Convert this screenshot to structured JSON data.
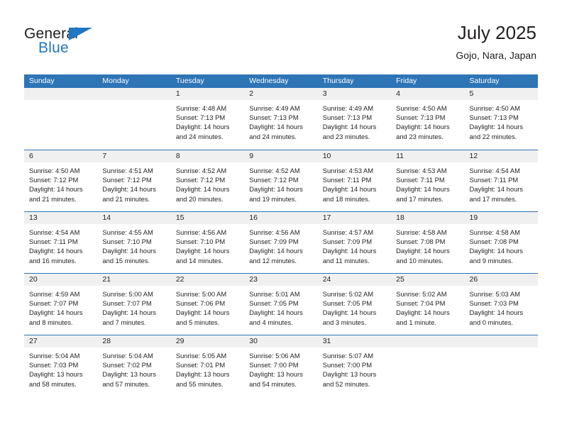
{
  "logo": {
    "top_word": "General",
    "bottom_word": "Blue",
    "flag_icon": "triangle-flag-icon"
  },
  "header": {
    "title": "July 2025",
    "location": "Gojo, Nara, Japan"
  },
  "colors": {
    "header_blue": "#2e75b6",
    "daynum_band": "#f0f0f0",
    "logo_blue": "#1f76c2",
    "text": "#231f20"
  },
  "calendar": {
    "weekday_headers": [
      "Sunday",
      "Monday",
      "Tuesday",
      "Wednesday",
      "Thursday",
      "Friday",
      "Saturday"
    ],
    "weeks": [
      [
        {
          "day": "",
          "lines": []
        },
        {
          "day": "",
          "lines": []
        },
        {
          "day": "1",
          "lines": [
            "Sunrise: 4:48 AM",
            "Sunset: 7:13 PM",
            "Daylight: 14 hours",
            "and 24 minutes."
          ]
        },
        {
          "day": "2",
          "lines": [
            "Sunrise: 4:49 AM",
            "Sunset: 7:13 PM",
            "Daylight: 14 hours",
            "and 24 minutes."
          ]
        },
        {
          "day": "3",
          "lines": [
            "Sunrise: 4:49 AM",
            "Sunset: 7:13 PM",
            "Daylight: 14 hours",
            "and 23 minutes."
          ]
        },
        {
          "day": "4",
          "lines": [
            "Sunrise: 4:50 AM",
            "Sunset: 7:13 PM",
            "Daylight: 14 hours",
            "and 23 minutes."
          ]
        },
        {
          "day": "5",
          "lines": [
            "Sunrise: 4:50 AM",
            "Sunset: 7:13 PM",
            "Daylight: 14 hours",
            "and 22 minutes."
          ]
        }
      ],
      [
        {
          "day": "6",
          "lines": [
            "Sunrise: 4:50 AM",
            "Sunset: 7:12 PM",
            "Daylight: 14 hours",
            "and 21 minutes."
          ]
        },
        {
          "day": "7",
          "lines": [
            "Sunrise: 4:51 AM",
            "Sunset: 7:12 PM",
            "Daylight: 14 hours",
            "and 21 minutes."
          ]
        },
        {
          "day": "8",
          "lines": [
            "Sunrise: 4:52 AM",
            "Sunset: 7:12 PM",
            "Daylight: 14 hours",
            "and 20 minutes."
          ]
        },
        {
          "day": "9",
          "lines": [
            "Sunrise: 4:52 AM",
            "Sunset: 7:12 PM",
            "Daylight: 14 hours",
            "and 19 minutes."
          ]
        },
        {
          "day": "10",
          "lines": [
            "Sunrise: 4:53 AM",
            "Sunset: 7:11 PM",
            "Daylight: 14 hours",
            "and 18 minutes."
          ]
        },
        {
          "day": "11",
          "lines": [
            "Sunrise: 4:53 AM",
            "Sunset: 7:11 PM",
            "Daylight: 14 hours",
            "and 17 minutes."
          ]
        },
        {
          "day": "12",
          "lines": [
            "Sunrise: 4:54 AM",
            "Sunset: 7:11 PM",
            "Daylight: 14 hours",
            "and 17 minutes."
          ]
        }
      ],
      [
        {
          "day": "13",
          "lines": [
            "Sunrise: 4:54 AM",
            "Sunset: 7:11 PM",
            "Daylight: 14 hours",
            "and 16 minutes."
          ]
        },
        {
          "day": "14",
          "lines": [
            "Sunrise: 4:55 AM",
            "Sunset: 7:10 PM",
            "Daylight: 14 hours",
            "and 15 minutes."
          ]
        },
        {
          "day": "15",
          "lines": [
            "Sunrise: 4:56 AM",
            "Sunset: 7:10 PM",
            "Daylight: 14 hours",
            "and 14 minutes."
          ]
        },
        {
          "day": "16",
          "lines": [
            "Sunrise: 4:56 AM",
            "Sunset: 7:09 PM",
            "Daylight: 14 hours",
            "and 12 minutes."
          ]
        },
        {
          "day": "17",
          "lines": [
            "Sunrise: 4:57 AM",
            "Sunset: 7:09 PM",
            "Daylight: 14 hours",
            "and 11 minutes."
          ]
        },
        {
          "day": "18",
          "lines": [
            "Sunrise: 4:58 AM",
            "Sunset: 7:08 PM",
            "Daylight: 14 hours",
            "and 10 minutes."
          ]
        },
        {
          "day": "19",
          "lines": [
            "Sunrise: 4:58 AM",
            "Sunset: 7:08 PM",
            "Daylight: 14 hours",
            "and 9 minutes."
          ]
        }
      ],
      [
        {
          "day": "20",
          "lines": [
            "Sunrise: 4:59 AM",
            "Sunset: 7:07 PM",
            "Daylight: 14 hours",
            "and 8 minutes."
          ]
        },
        {
          "day": "21",
          "lines": [
            "Sunrise: 5:00 AM",
            "Sunset: 7:07 PM",
            "Daylight: 14 hours",
            "and 7 minutes."
          ]
        },
        {
          "day": "22",
          "lines": [
            "Sunrise: 5:00 AM",
            "Sunset: 7:06 PM",
            "Daylight: 14 hours",
            "and 5 minutes."
          ]
        },
        {
          "day": "23",
          "lines": [
            "Sunrise: 5:01 AM",
            "Sunset: 7:05 PM",
            "Daylight: 14 hours",
            "and 4 minutes."
          ]
        },
        {
          "day": "24",
          "lines": [
            "Sunrise: 5:02 AM",
            "Sunset: 7:05 PM",
            "Daylight: 14 hours",
            "and 3 minutes."
          ]
        },
        {
          "day": "25",
          "lines": [
            "Sunrise: 5:02 AM",
            "Sunset: 7:04 PM",
            "Daylight: 14 hours",
            "and 1 minute."
          ]
        },
        {
          "day": "26",
          "lines": [
            "Sunrise: 5:03 AM",
            "Sunset: 7:03 PM",
            "Daylight: 14 hours",
            "and 0 minutes."
          ]
        }
      ],
      [
        {
          "day": "27",
          "lines": [
            "Sunrise: 5:04 AM",
            "Sunset: 7:03 PM",
            "Daylight: 13 hours",
            "and 58 minutes."
          ]
        },
        {
          "day": "28",
          "lines": [
            "Sunrise: 5:04 AM",
            "Sunset: 7:02 PM",
            "Daylight: 13 hours",
            "and 57 minutes."
          ]
        },
        {
          "day": "29",
          "lines": [
            "Sunrise: 5:05 AM",
            "Sunset: 7:01 PM",
            "Daylight: 13 hours",
            "and 55 minutes."
          ]
        },
        {
          "day": "30",
          "lines": [
            "Sunrise: 5:06 AM",
            "Sunset: 7:00 PM",
            "Daylight: 13 hours",
            "and 54 minutes."
          ]
        },
        {
          "day": "31",
          "lines": [
            "Sunrise: 5:07 AM",
            "Sunset: 7:00 PM",
            "Daylight: 13 hours",
            "and 52 minutes."
          ]
        },
        {
          "day": "",
          "lines": []
        },
        {
          "day": "",
          "lines": []
        }
      ]
    ]
  }
}
